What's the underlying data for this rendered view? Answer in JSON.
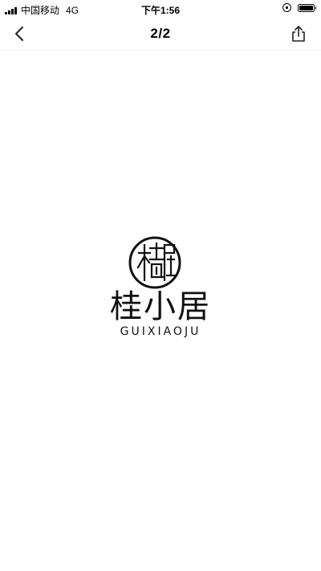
{
  "status_bar": {
    "carrier": "中国移动",
    "network": "4G",
    "time": "下午1:56",
    "icons": [
      "signal-icon",
      "orientation-lock-icon",
      "battery-icon"
    ]
  },
  "nav": {
    "title": "2/2",
    "back_icon": "chevron-left-icon",
    "share_icon": "share-icon"
  },
  "image": {
    "logo_text": "桂小居",
    "logo_subtext": "GUIXIAOJU",
    "seal_text": "桂小居",
    "logo_color": "#111111"
  }
}
